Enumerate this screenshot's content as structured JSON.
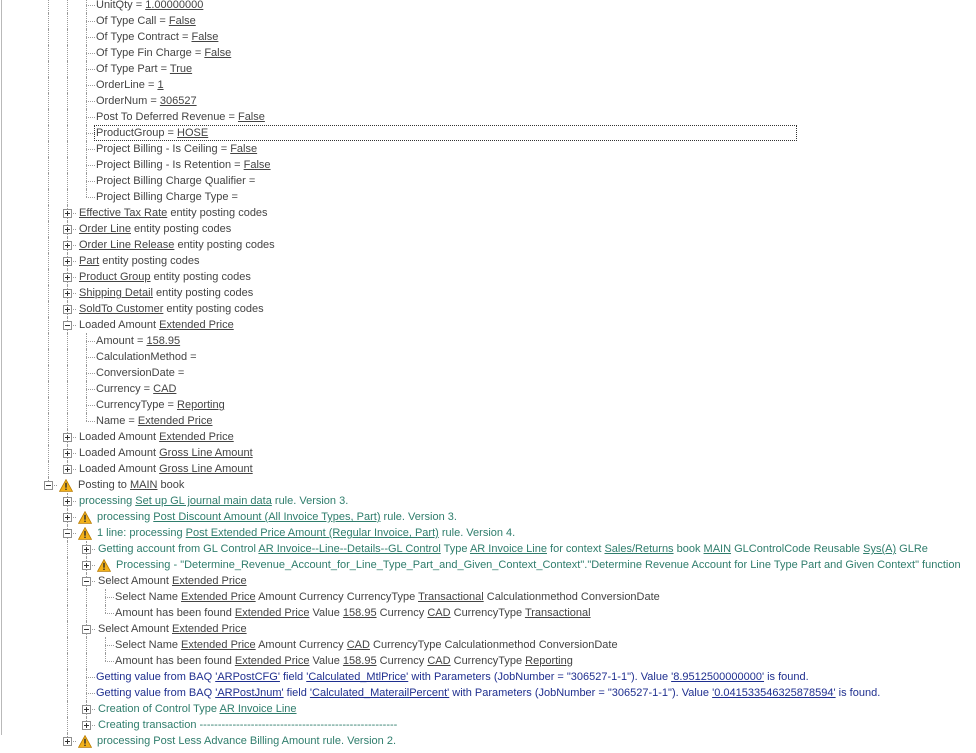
{
  "tree": {
    "rows": [
      {
        "depth": 4,
        "segs": [
          {
            "t": "UnitQty = "
          },
          {
            "t": "1.00000000",
            "u": true
          }
        ]
      },
      {
        "depth": 4,
        "segs": [
          {
            "t": "Of Type Call = "
          },
          {
            "t": "False",
            "u": true
          }
        ]
      },
      {
        "depth": 4,
        "segs": [
          {
            "t": "Of Type Contract = "
          },
          {
            "t": "False",
            "u": true
          }
        ]
      },
      {
        "depth": 4,
        "segs": [
          {
            "t": "Of Type Fin Charge = "
          },
          {
            "t": "False",
            "u": true
          }
        ]
      },
      {
        "depth": 4,
        "segs": [
          {
            "t": "Of Type Part = "
          },
          {
            "t": "True",
            "u": true
          }
        ]
      },
      {
        "depth": 4,
        "segs": [
          {
            "t": "OrderLine = "
          },
          {
            "t": "1",
            "u": true
          }
        ]
      },
      {
        "depth": 4,
        "segs": [
          {
            "t": "OrderNum = "
          },
          {
            "t": "306527",
            "u": true
          }
        ]
      },
      {
        "depth": 4,
        "segs": [
          {
            "t": "Post To Deferred Revenue = "
          },
          {
            "t": "False",
            "u": true
          }
        ]
      },
      {
        "depth": 4,
        "selected": true,
        "segs": [
          {
            "t": "ProductGroup = "
          },
          {
            "t": "HOSE",
            "u": true
          }
        ]
      },
      {
        "depth": 4,
        "segs": [
          {
            "t": "Project Billing - Is Ceiling = "
          },
          {
            "t": "False",
            "u": true
          }
        ]
      },
      {
        "depth": 4,
        "segs": [
          {
            "t": "Project Billing - Is Retention = "
          },
          {
            "t": "False",
            "u": true
          }
        ]
      },
      {
        "depth": 4,
        "segs": [
          {
            "t": "Project Billing Charge Qualifier = "
          }
        ]
      },
      {
        "depth": 4,
        "last": true,
        "segs": [
          {
            "t": "Project Billing Charge Type = "
          }
        ]
      },
      {
        "depth": 3,
        "toggle": "plus",
        "segs": [
          {
            "t": "Effective Tax Rate",
            "u": true
          },
          {
            "t": "  entity posting codes"
          }
        ]
      },
      {
        "depth": 3,
        "toggle": "plus",
        "segs": [
          {
            "t": "Order Line",
            "u": true
          },
          {
            "t": "  entity posting codes"
          }
        ]
      },
      {
        "depth": 3,
        "toggle": "plus",
        "segs": [
          {
            "t": "Order Line Release",
            "u": true
          },
          {
            "t": "  entity posting codes"
          }
        ]
      },
      {
        "depth": 3,
        "toggle": "plus",
        "segs": [
          {
            "t": "Part",
            "u": true
          },
          {
            "t": "  entity posting codes"
          }
        ]
      },
      {
        "depth": 3,
        "toggle": "plus",
        "segs": [
          {
            "t": "Product Group",
            "u": true
          },
          {
            "t": "  entity posting codes"
          }
        ]
      },
      {
        "depth": 3,
        "toggle": "plus",
        "segs": [
          {
            "t": "Shipping Detail",
            "u": true
          },
          {
            "t": "  entity posting codes"
          }
        ]
      },
      {
        "depth": 3,
        "toggle": "plus",
        "segs": [
          {
            "t": "SoldTo Customer",
            "u": true
          },
          {
            "t": "  entity posting codes"
          }
        ]
      },
      {
        "depth": 3,
        "toggle": "minus",
        "segs": [
          {
            "t": "Loaded Amount  "
          },
          {
            "t": "Extended Price",
            "u": true
          }
        ]
      },
      {
        "depth": 4,
        "segs": [
          {
            "t": "Amount = "
          },
          {
            "t": "158.95",
            "u": true
          }
        ]
      },
      {
        "depth": 4,
        "segs": [
          {
            "t": "CalculationMethod = "
          }
        ]
      },
      {
        "depth": 4,
        "segs": [
          {
            "t": "ConversionDate = "
          }
        ]
      },
      {
        "depth": 4,
        "segs": [
          {
            "t": "Currency = "
          },
          {
            "t": "CAD",
            "u": true
          }
        ]
      },
      {
        "depth": 4,
        "segs": [
          {
            "t": "CurrencyType = "
          },
          {
            "t": "Reporting",
            "u": true
          }
        ]
      },
      {
        "depth": 4,
        "last": true,
        "segs": [
          {
            "t": "Name = "
          },
          {
            "t": "Extended Price",
            "u": true
          }
        ]
      },
      {
        "depth": 3,
        "toggle": "plus",
        "segs": [
          {
            "t": "Loaded Amount  "
          },
          {
            "t": "Extended Price",
            "u": true
          }
        ]
      },
      {
        "depth": 3,
        "toggle": "plus",
        "segs": [
          {
            "t": "Loaded Amount  "
          },
          {
            "t": "Gross Line Amount",
            "u": true
          }
        ]
      },
      {
        "depth": 3,
        "toggle": "plus",
        "last": true,
        "segs": [
          {
            "t": "Loaded Amount  "
          },
          {
            "t": "Gross Line Amount",
            "u": true
          }
        ]
      },
      {
        "depth": 2,
        "toggle": "minus",
        "warn": true,
        "segs": [
          {
            "t": "Posting to  "
          },
          {
            "t": "MAIN",
            "u": true
          },
          {
            "t": "  book"
          }
        ]
      },
      {
        "depth": 3,
        "toggle": "plus",
        "tone": "green",
        "segs": [
          {
            "t": "processing "
          },
          {
            "t": "Set up GL journal main data",
            "u": true
          },
          {
            "t": "   rule. Version 3."
          }
        ]
      },
      {
        "depth": 3,
        "toggle": "plus",
        "warn": true,
        "tone": "green",
        "segs": [
          {
            "t": "processing "
          },
          {
            "t": "Post Discount Amount (All Invoice Types, Part)",
            "u": true
          },
          {
            "t": "   rule. Version 3."
          }
        ]
      },
      {
        "depth": 3,
        "toggle": "minus",
        "warn": true,
        "tone": "green",
        "segs": [
          {
            "t": "1 line: processing "
          },
          {
            "t": "Post Extended Price Amount (Regular Invoice, Part)",
            "u": true
          },
          {
            "t": "   rule. Version 4."
          }
        ]
      },
      {
        "depth": 4,
        "toggle": "plus",
        "tone": "green",
        "segs": [
          {
            "t": "Getting account from GL Control  "
          },
          {
            "t": "AR Invoice--Line--Details--GL Control",
            "u": true
          },
          {
            "t": "  Type "
          },
          {
            "t": "AR Invoice Line",
            "u": true
          },
          {
            "t": "  for context "
          },
          {
            "t": "Sales/Returns",
            "u": true
          },
          {
            "t": "  book "
          },
          {
            "t": "MAIN",
            "u": true
          },
          {
            "t": "  GLControlCode  Reusable "
          },
          {
            "t": "Sys(A)",
            "u": true
          },
          {
            "t": "  GLRe"
          }
        ]
      },
      {
        "depth": 4,
        "toggle": "plus",
        "warn": true,
        "tone": "green",
        "segs": [
          {
            "t": "Processing - \"Determine_Revenue_Account_for_Line_Type_Part_and_Given_Context_Context\".\"Determine Revenue Account for Line Type Part and Given Context\" function"
          }
        ]
      },
      {
        "depth": 4,
        "toggle": "minus",
        "segs": [
          {
            "t": "Select Amount  "
          },
          {
            "t": "Extended Price",
            "u": true
          }
        ]
      },
      {
        "depth": 5,
        "segs": [
          {
            "t": "Select Name  "
          },
          {
            "t": "Extended Price",
            "u": true
          },
          {
            "t": "  Amount  Currency  CurrencyType "
          },
          {
            "t": "Transactional",
            "u": true
          },
          {
            "t": "  Calculationmethod  ConversionDate"
          }
        ]
      },
      {
        "depth": 5,
        "last": true,
        "segs": [
          {
            "t": "Amount has been found  "
          },
          {
            "t": "Extended Price",
            "u": true
          },
          {
            "t": "  Value  "
          },
          {
            "t": "158.95",
            "u": true
          },
          {
            "t": "  Currency "
          },
          {
            "t": "CAD",
            "u": true
          },
          {
            "t": "  CurrencyType "
          },
          {
            "t": "Transactional",
            "u": true
          }
        ]
      },
      {
        "depth": 4,
        "toggle": "minus",
        "segs": [
          {
            "t": "Select Amount  "
          },
          {
            "t": "Extended Price",
            "u": true
          }
        ]
      },
      {
        "depth": 5,
        "segs": [
          {
            "t": "Select Name  "
          },
          {
            "t": "Extended Price",
            "u": true
          },
          {
            "t": "  Amount  Currency "
          },
          {
            "t": "CAD",
            "u": true
          },
          {
            "t": "  CurrencyType  Calculationmethod  ConversionDate"
          }
        ]
      },
      {
        "depth": 5,
        "last": true,
        "segs": [
          {
            "t": "Amount has been found  "
          },
          {
            "t": "Extended Price",
            "u": true
          },
          {
            "t": "  Value  "
          },
          {
            "t": "158.95",
            "u": true
          },
          {
            "t": "  Currency "
          },
          {
            "t": "CAD",
            "u": true
          },
          {
            "t": "  CurrencyType "
          },
          {
            "t": "Reporting",
            "u": true
          }
        ]
      },
      {
        "depth": 4,
        "tone": "blue",
        "segs": [
          {
            "t": "Getting value from BAQ  "
          },
          {
            "t": "'ARPostCFG'",
            "u": true
          },
          {
            "t": "  field "
          },
          {
            "t": "'Calculated_MtlPrice'",
            "u": true
          },
          {
            "t": "  with Parameters (JobNumber = \"306527-1-1\"). Value   "
          },
          {
            "t": "'8.9512500000000'",
            "u": true
          },
          {
            "t": "    is found."
          }
        ]
      },
      {
        "depth": 4,
        "tone": "blue",
        "segs": [
          {
            "t": "Getting value from BAQ  "
          },
          {
            "t": "'ARPostJnum'",
            "u": true
          },
          {
            "t": "  field "
          },
          {
            "t": "'Calculated_MaterailPercent'",
            "u": true
          },
          {
            "t": "  with Parameters (JobNumber = \"306527-1-1\"). Value   "
          },
          {
            "t": "'0.041533546325878594'",
            "u": true
          },
          {
            "t": "    is found."
          }
        ]
      },
      {
        "depth": 4,
        "toggle": "plus",
        "tone": "green",
        "segs": [
          {
            "t": "Creation of Control Type  "
          },
          {
            "t": "AR Invoice Line",
            "u": true
          }
        ]
      },
      {
        "depth": 4,
        "toggle": "plus",
        "tone": "green",
        "segs": [
          {
            "t": "Creating transaction ------------------------------------------------------"
          }
        ]
      },
      {
        "depth": 3,
        "toggle": "plus",
        "warn": true,
        "tone": "green",
        "segs": [
          {
            "t": "processing Post Less Advance Billing Amount   rule. Version 2."
          }
        ]
      }
    ]
  },
  "colors": {
    "green": "#2f7d6c",
    "blue": "#1f2f8f",
    "text": "#444444",
    "warning": "#f2b11b"
  },
  "icons": {
    "warning": "warning-icon",
    "expand": "expand-plus-icon",
    "collapse": "collapse-minus-icon"
  }
}
